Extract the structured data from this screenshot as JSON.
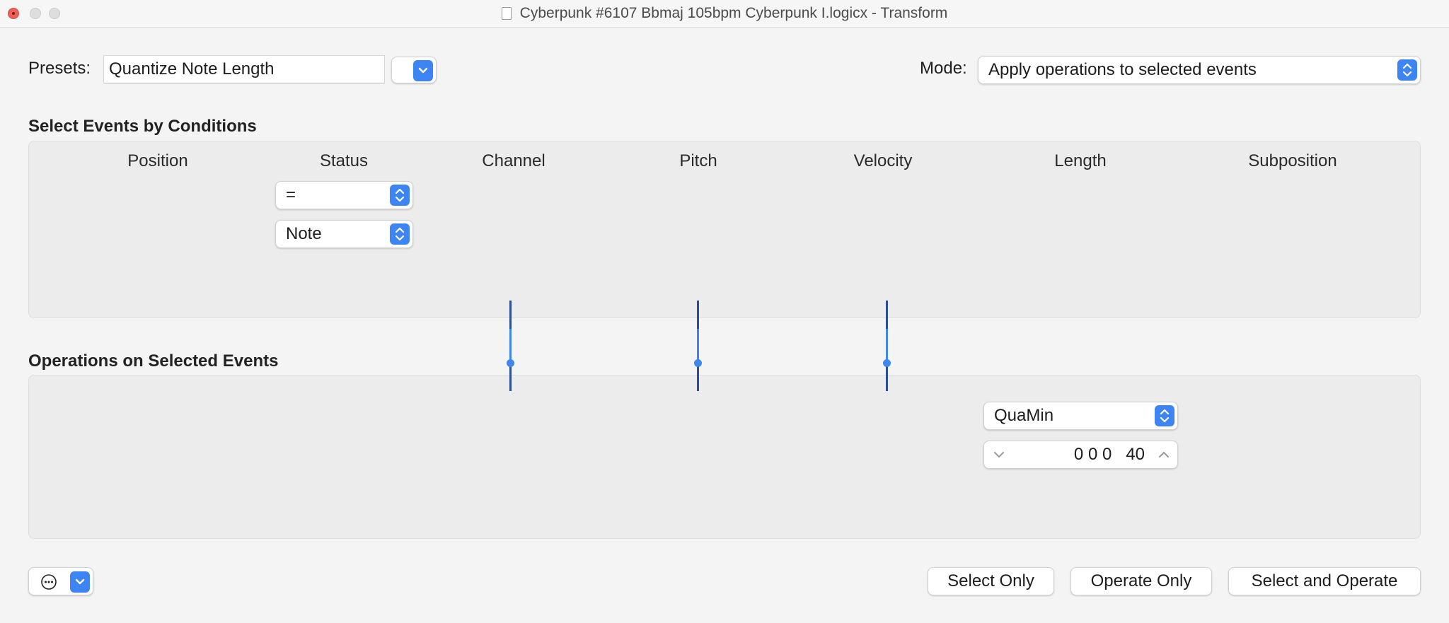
{
  "window": {
    "title": "Cyberpunk #6107 Bbmaj 105bpm Cyberpunk I.logicx - Transform"
  },
  "presets": {
    "label": "Presets:",
    "value": "Quantize Note Length"
  },
  "mode": {
    "label": "Mode:",
    "value": "Apply operations to selected events"
  },
  "conditions": {
    "title": "Select Events by Conditions",
    "columns": [
      "Position",
      "Status",
      "Channel",
      "Pitch",
      "Velocity",
      "Length",
      "Subposition"
    ],
    "status_operator": "=",
    "status_value": "Note"
  },
  "operations": {
    "title": "Operations on Selected Events",
    "length_operation": "QuaMin",
    "length_value": "0 0 0   40"
  },
  "buttons": {
    "select_only": "Select Only",
    "operate_only": "Operate Only",
    "select_and_operate": "Select and Operate"
  },
  "icons": {
    "more": "ellipsis-circle-icon",
    "dropdown": "chevron-down-icon",
    "updown": "chevron-updown-icon"
  },
  "colors": {
    "accent": "#3d84f5",
    "connector_dark": "#2b4f96"
  }
}
